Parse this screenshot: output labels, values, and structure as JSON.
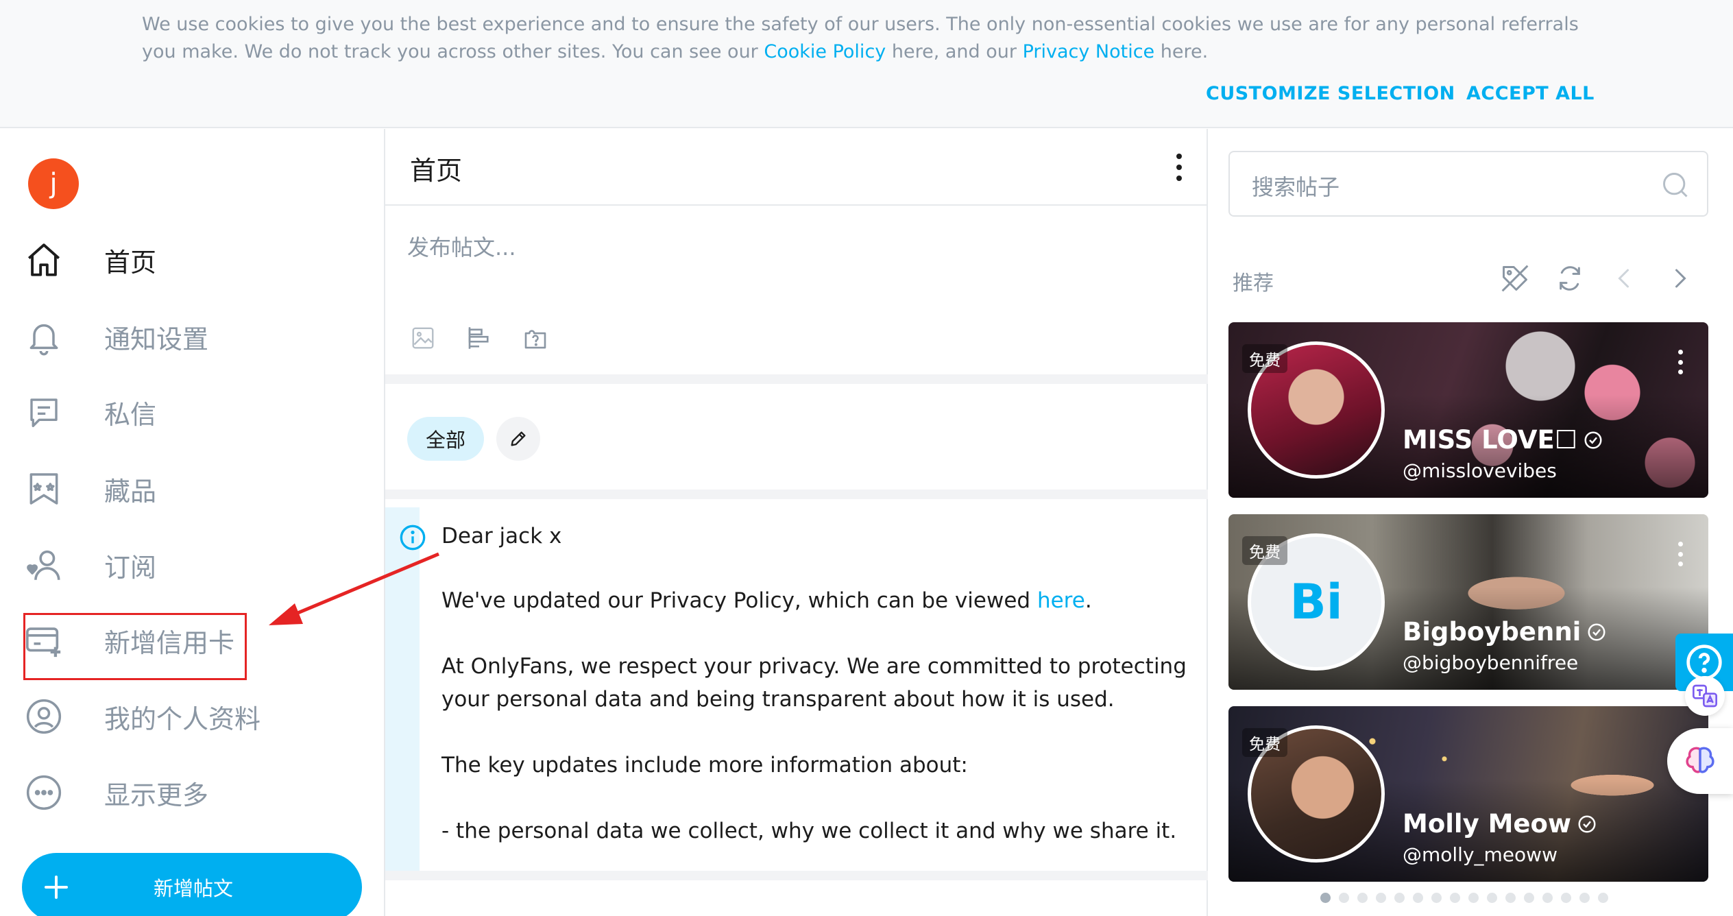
{
  "cookie_banner": {
    "text_before_policy": "We use cookies to give you the best experience and to ensure the safety of our users. The only non-essential cookies we use are for any personal referrals you make. We do not track you across other sites. You can see our ",
    "cookie_policy_link": "Cookie Policy",
    "text_middle": " here, and our ",
    "privacy_notice_link": "Privacy Notice",
    "text_end": " here.",
    "customize_label": "CUSTOMIZE SELECTION",
    "accept_label": "ACCEPT ALL"
  },
  "user": {
    "avatar_letter": "j"
  },
  "sidebar": {
    "items": [
      {
        "label": "首页",
        "icon": "home-icon",
        "active": true
      },
      {
        "label": "通知设置",
        "icon": "bell-icon"
      },
      {
        "label": "私信",
        "icon": "message-icon"
      },
      {
        "label": "藏品",
        "icon": "collections-icon"
      },
      {
        "label": "订阅",
        "icon": "subscriptions-icon"
      },
      {
        "label": "新增信用卡",
        "icon": "add-card-icon"
      },
      {
        "label": "我的个人资料",
        "icon": "profile-icon"
      },
      {
        "label": "显示更多",
        "icon": "more-icon"
      }
    ],
    "new_post_label": "新增帖文"
  },
  "main": {
    "title": "首页",
    "composer_placeholder": "发布帖文...",
    "filter_all": "全部",
    "notice": {
      "greeting": "Dear jack x",
      "p1_before": "We've updated our Privacy Policy, which can be viewed ",
      "p1_link": "here",
      "p1_after": ".",
      "p2": "At OnlyFans, we respect your privacy. We are committed to protecting your personal data and being transparent about how it is used.",
      "p3": "The key updates include more information about:",
      "p4": "- the personal data we collect, why we collect it and why we share it."
    }
  },
  "right": {
    "search_placeholder": "搜索帖子",
    "recommend_title": "推荐",
    "cards": [
      {
        "free_badge": "免费",
        "name": "MISS LOVE☐",
        "handle": "@misslovevibes"
      },
      {
        "free_badge": "免费",
        "name": "Bigboybenni",
        "handle": "@bigboybennifree",
        "initials": "Bi"
      },
      {
        "free_badge": "免费",
        "name": "Molly Meow",
        "handle": "@molly_meoww"
      }
    ],
    "pagination_count": 16,
    "pagination_active": 0
  },
  "colors": {
    "accent": "#00aff0",
    "muted_text": "#8a96a3",
    "annotation_red": "#e52424",
    "avatar": "#f5501e"
  }
}
